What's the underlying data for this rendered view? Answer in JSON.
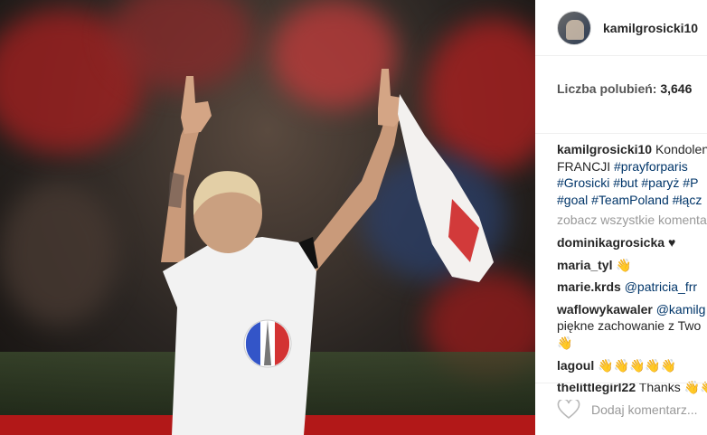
{
  "post": {
    "author": "kamilgrosicki10",
    "likes_label": "Liczba polubień:",
    "likes_count": "3,646",
    "caption_user": "kamilgrosicki10",
    "caption_lines": [
      "Kondolencje",
      "FRANCJI ",
      "#prayforparis",
      "#Grosicki #but #paryż #P",
      "#goal #TeamPoland #łącz"
    ],
    "view_all": "zobacz wszystkie komentarze",
    "comments": [
      {
        "user": "dominikagrosicka",
        "text": "♥"
      },
      {
        "user": "maria_tyl",
        "text": "👋"
      },
      {
        "user": "marie.krds",
        "text": "@patricia_frr"
      },
      {
        "user": "waflowykawaler",
        "text": "@kamilg",
        "extra": [
          "piękne zachowanie z Two",
          "👋"
        ]
      },
      {
        "user": "lagoul",
        "text": "👋👋👋👋👋"
      },
      {
        "user": "thelittlegirl22",
        "text": "Thanks 👋👋"
      }
    ],
    "add_comment_placeholder": "Dodaj komentarz..."
  },
  "icons": {
    "like": "heart-outline-icon"
  },
  "colors": {
    "link": "#003569",
    "muted": "#999999",
    "text": "#262626"
  }
}
